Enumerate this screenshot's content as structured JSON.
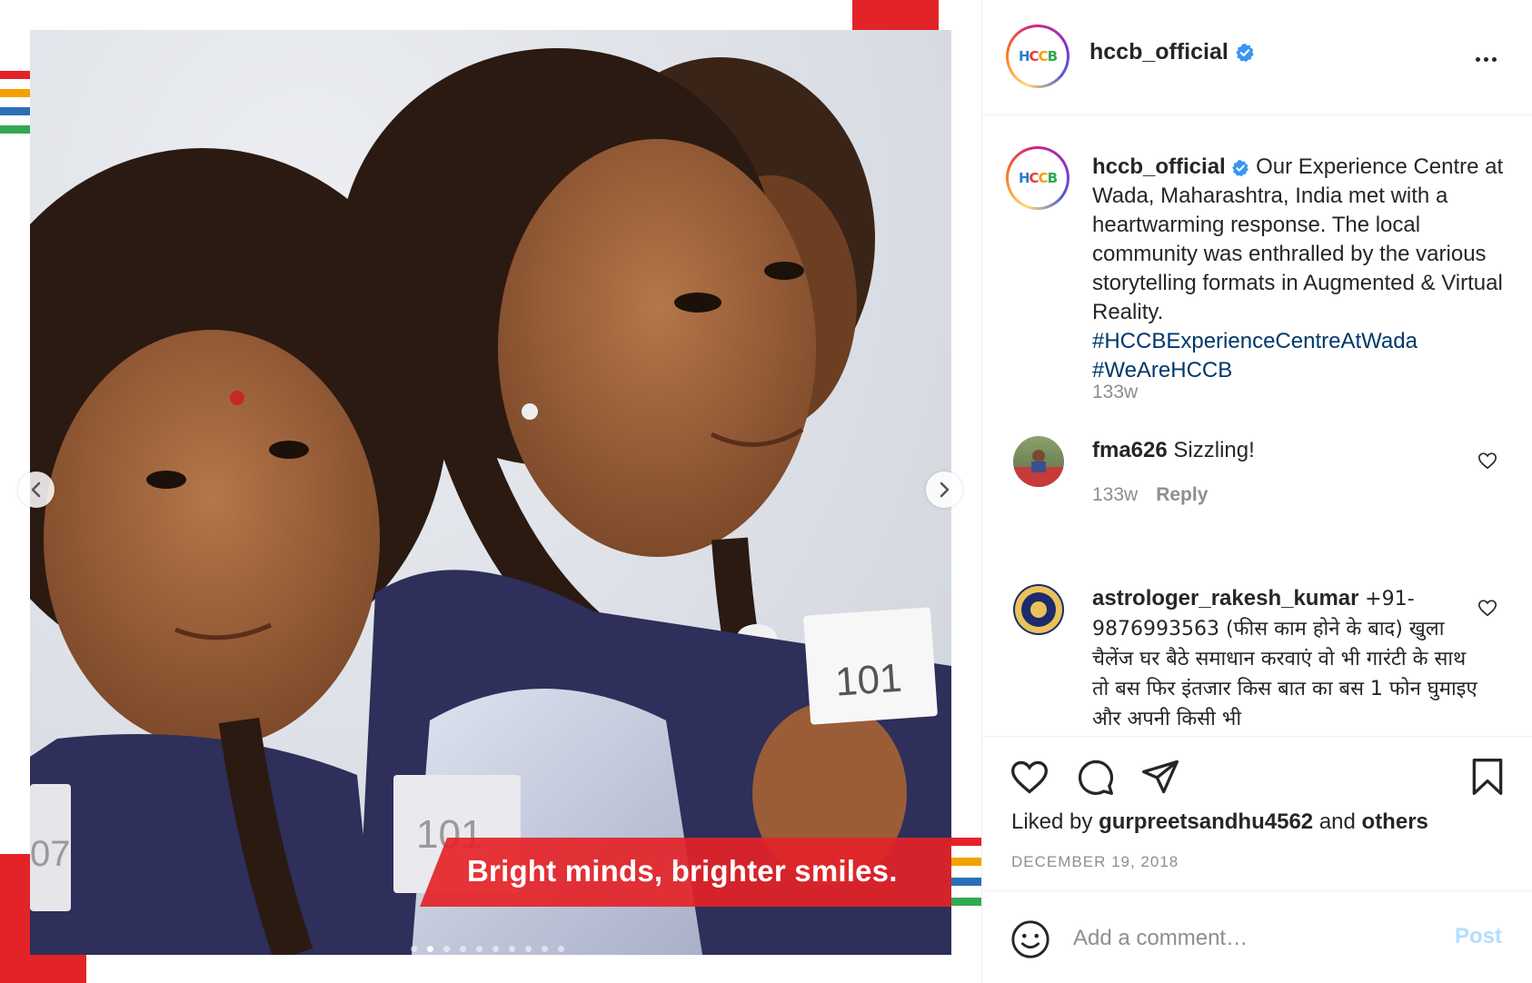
{
  "post": {
    "username": "hccb_official",
    "verified": true,
    "logo_text": {
      "h": "H",
      "c1": "C",
      "c2": "C",
      "b": "B"
    },
    "image_caption": "Bright minds, brighter smiles.",
    "card_numbers": [
      "101",
      "101",
      "07"
    ],
    "carousel": {
      "total_slides": 10,
      "active_index": 1
    },
    "caption": {
      "text": "Our Experience Centre at Wada, Maharashtra, India met with a heartwarming response. The local community was enthralled by the various storytelling formats in Augmented & Virtual Reality.",
      "hashtags": [
        "#HCCBExperienceCentreAtWada",
        "#WeAreHCCB"
      ],
      "time": "133w"
    },
    "comments": [
      {
        "username": "fma626",
        "text": "Sizzling!",
        "time": "133w",
        "reply_label": "Reply"
      },
      {
        "username": "astrologer_rakesh_kumar",
        "text": "+91-9876993563 (फीस काम होने के बाद) खुला चैलेंज घर बैठे समाधान करवाएं वो भी गारंटी के साथ तो बस फिर इंतजार किस बात का बस 1 फोन घुमाइए और अपनी किसी भी"
      }
    ],
    "likes": {
      "prefix": "Liked by",
      "user": "gurpreetsandhu4562",
      "joiner": "and",
      "others": "others"
    },
    "date": "DECEMBER 19, 2018",
    "add_comment": {
      "placeholder": "Add a comment…",
      "post_label": "Post"
    }
  },
  "colors": {
    "brand_red": "#e42328",
    "link_blue": "#00376b",
    "verified_blue": "#3897f0",
    "muted": "#8e8e8e",
    "post_disabled": "#b2dffc"
  },
  "icons": [
    "chevron-left-icon",
    "chevron-right-icon",
    "verified-badge-icon",
    "more-options-icon",
    "heart-icon",
    "comment-icon",
    "share-icon",
    "bookmark-icon",
    "emoji-icon"
  ]
}
